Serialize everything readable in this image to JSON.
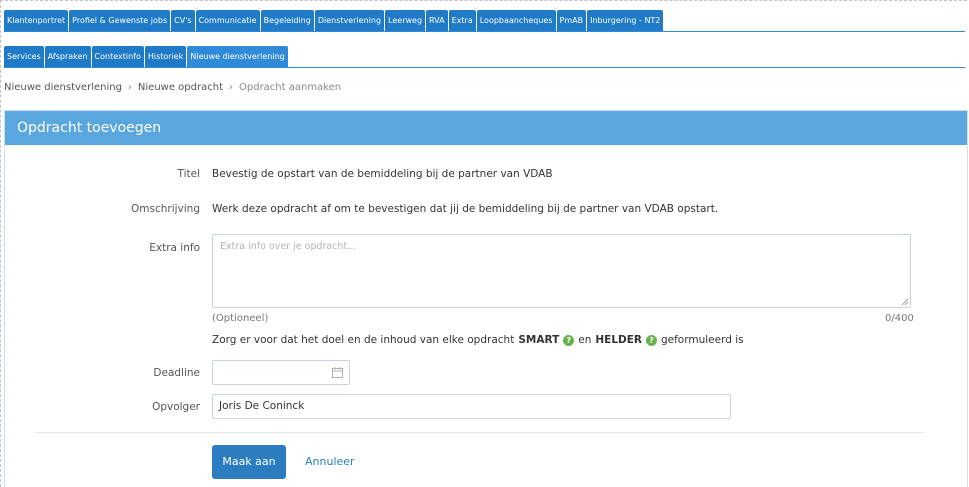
{
  "top_tabs": [
    {
      "label": "Klantenportret",
      "active": false
    },
    {
      "label": "Profiel & Gewenste jobs",
      "active": false
    },
    {
      "label": "CV's",
      "active": false
    },
    {
      "label": "Communicatie",
      "active": false
    },
    {
      "label": "Begeleiding",
      "active": false
    },
    {
      "label": "Dienstverlening",
      "active": false
    },
    {
      "label": "Leerweg",
      "active": false
    },
    {
      "label": "RVA",
      "active": false
    },
    {
      "label": "Extra",
      "active": false
    },
    {
      "label": "Loopbaancheques",
      "active": false
    },
    {
      "label": "PmAB",
      "active": false
    },
    {
      "label": "Inburgering - NT2",
      "active": false
    }
  ],
  "sub_tabs": [
    {
      "label": "Services",
      "active": false
    },
    {
      "label": "Afspraken",
      "active": false
    },
    {
      "label": "Contextinfo",
      "active": false
    },
    {
      "label": "Historiek",
      "active": false
    },
    {
      "label": "Nieuwe dienstverlening",
      "active": true
    }
  ],
  "breadcrumb": {
    "items": [
      "Nieuwe dienstverlening",
      "Nieuwe opdracht",
      "Opdracht aanmaken"
    ],
    "separator": "›"
  },
  "panel": {
    "title": "Opdracht toevoegen"
  },
  "form": {
    "titel": {
      "label": "Titel",
      "value": "Bevestig de opstart van de bemiddeling bij de partner van VDAB"
    },
    "omschrijving": {
      "label": "Omschrijving",
      "value": "Werk deze opdracht af om te bevestigen dat jij de bemiddeling bij de partner van VDAB opstart."
    },
    "extra_info": {
      "label": "Extra info",
      "placeholder": "Extra info over je opdracht...",
      "hint": "(Optioneel)",
      "counter": "0/400"
    },
    "smart_hint": {
      "prefix": "Zorg er voor dat het doel en de inhoud van elke opdracht",
      "smart": "SMART",
      "middle": "en",
      "helder": "HELDER",
      "suffix": "geformuleerd is",
      "help_glyph": "?"
    },
    "deadline": {
      "label": "Deadline",
      "value": ""
    },
    "opvolger": {
      "label": "Opvolger",
      "value": "Joris De Coninck"
    }
  },
  "actions": {
    "submit": "Maak aan",
    "cancel": "Annuleer"
  },
  "colors": {
    "tab": "#1f7ac7",
    "header": "#5aa6de",
    "primary": "#2c7cc0",
    "help": "#6ab04c"
  }
}
